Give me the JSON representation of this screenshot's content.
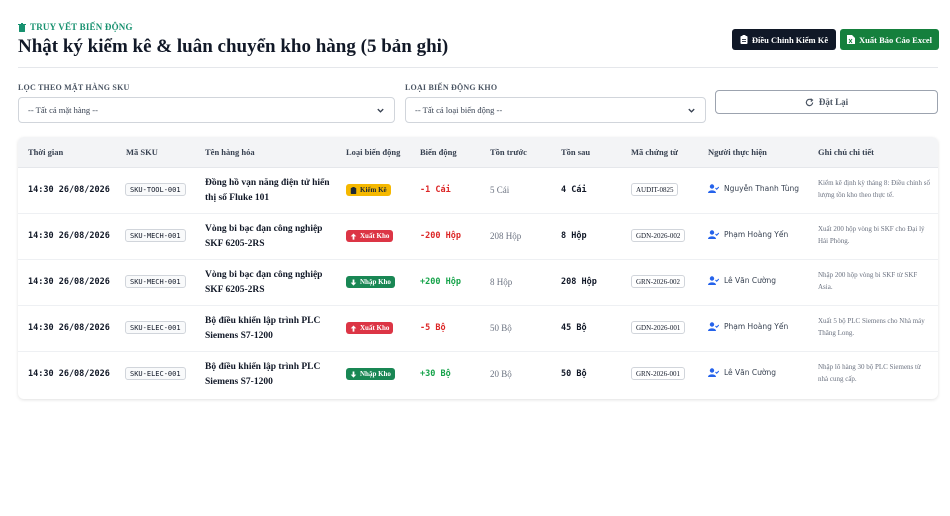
{
  "header": {
    "eyebrow": "TRUY VẾT BIẾN ĐỘNG",
    "title": "Nhật ký kiểm kê & luân chuyển kho hàng (5 bản ghi)"
  },
  "actions": {
    "adjust_label": "Điều Chỉnh Kiểm Kê",
    "export_label": "Xuất Báo Cáo Excel",
    "reset_label": "Đặt Lại"
  },
  "filters": {
    "sku_label": "LỌC THEO MẶT HÀNG SKU",
    "sku_value": "-- Tất cả mặt hàng --",
    "type_label": "LOẠI BIẾN ĐỘNG KHO",
    "type_value": "-- Tất cả loại biến động --"
  },
  "table": {
    "headers": [
      "Thời gian",
      "Mã SKU",
      "Tên hàng hóa",
      "Loại biến động",
      "Biến động",
      "Tồn trước",
      "Tồn sau",
      "Mã chứng từ",
      "Người thực hiện",
      "Ghi chú chi tiết"
    ],
    "rows": [
      {
        "time": "14:30 26/08/2026",
        "sku": "SKU-TOOL-001",
        "name": "Đồng hồ vạn năng điện tử hiển thị số Fluke 101",
        "type": "Kiểm Kê",
        "type_kind": "audit",
        "delta": "-1 Cái",
        "delta_kind": "neg",
        "before": "5 Cái",
        "after": "4 Cái",
        "doc": "AUDIT-0825",
        "user": "Nguyễn Thanh Tùng",
        "note": "Kiểm kê định kỳ tháng 8: Điều chỉnh số lượng tồn kho theo thực tế."
      },
      {
        "time": "14:30 26/08/2026",
        "sku": "SKU-MECH-001",
        "name": "Vòng bi bạc đạn công nghiệp SKF 6205-2RS",
        "type": "Xuất Kho",
        "type_kind": "out",
        "delta": "-200 Hộp",
        "delta_kind": "neg",
        "before": "208 Hộp",
        "after": "8 Hộp",
        "doc": "GDN-2026-002",
        "user": "Phạm Hoàng Yến",
        "note": "Xuất 200 hộp vòng bi SKF cho Đại lý Hải Phòng."
      },
      {
        "time": "14:30 26/08/2026",
        "sku": "SKU-MECH-001",
        "name": "Vòng bi bạc đạn công nghiệp SKF 6205-2RS",
        "type": "Nhập Kho",
        "type_kind": "in",
        "delta": "+200 Hộp",
        "delta_kind": "pos",
        "before": "8 Hộp",
        "after": "208 Hộp",
        "doc": "GRN-2026-002",
        "user": "Lê Văn Cường",
        "note": "Nhập 200 hộp vòng bi SKF từ SKF Asia."
      },
      {
        "time": "14:30 26/08/2026",
        "sku": "SKU-ELEC-001",
        "name": "Bộ điều khiển lập trình PLC Siemens S7-1200",
        "type": "Xuất Kho",
        "type_kind": "out",
        "delta": "-5 Bộ",
        "delta_kind": "neg",
        "before": "50 Bộ",
        "after": "45 Bộ",
        "doc": "GDN-2026-001",
        "user": "Phạm Hoàng Yến",
        "note": "Xuất 5 bộ PLC Siemens cho Nhà máy Thăng Long."
      },
      {
        "time": "14:30 26/08/2026",
        "sku": "SKU-ELEC-001",
        "name": "Bộ điều khiển lập trình PLC Siemens S7-1200",
        "type": "Nhập Kho",
        "type_kind": "in",
        "delta": "+30 Bộ",
        "delta_kind": "pos",
        "before": "20 Bộ",
        "after": "50 Bộ",
        "doc": "GRN-2026-001",
        "user": "Lê Văn Cường",
        "note": "Nhập lô hàng 30 bộ PLC Siemens từ nhà cung cấp."
      }
    ]
  },
  "colors": {
    "accent_teal": "#17916f",
    "dark_button": "#101827",
    "green_button": "#15803d",
    "audit_badge": "#f5b800",
    "out_badge": "#dc3545",
    "in_badge": "#198754"
  }
}
